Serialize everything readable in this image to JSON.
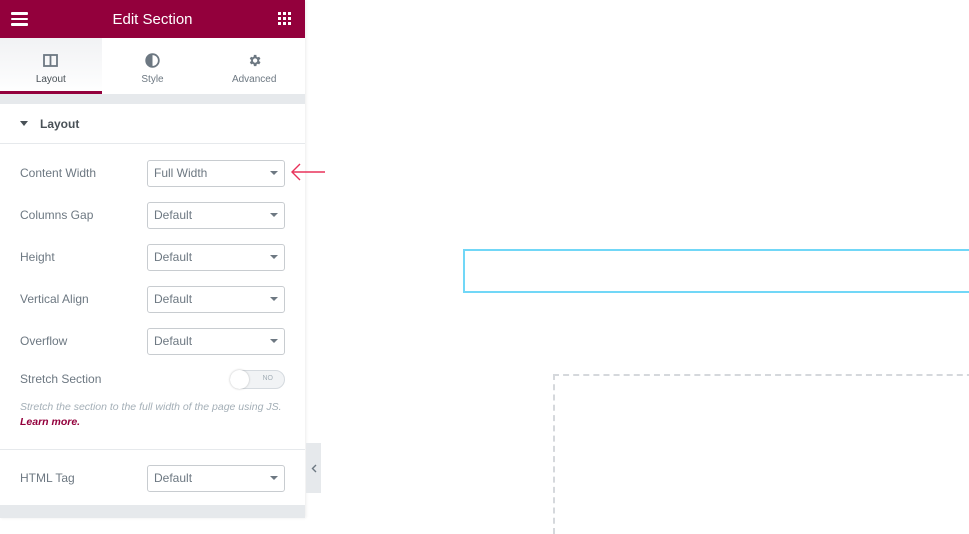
{
  "header": {
    "title": "Edit Section",
    "menu_icon": "hamburger-icon",
    "apps_icon": "grid-icon"
  },
  "tabs": [
    {
      "label": "Layout",
      "icon": "columns-icon",
      "active": true
    },
    {
      "label": "Style",
      "icon": "half-circle-icon",
      "active": false
    },
    {
      "label": "Advanced",
      "icon": "gear-icon",
      "active": false
    }
  ],
  "section": {
    "title": "Layout",
    "fields": [
      {
        "label": "Content Width",
        "value": "Full Width"
      },
      {
        "label": "Columns Gap",
        "value": "Default"
      },
      {
        "label": "Height",
        "value": "Default"
      },
      {
        "label": "Vertical Align",
        "value": "Default"
      },
      {
        "label": "Overflow",
        "value": "Default"
      }
    ],
    "stretch": {
      "label": "Stretch Section",
      "toggle_text": "NO",
      "description": "Stretch the section to the full width of the page using JS.",
      "link": "Learn more."
    },
    "html_tag": {
      "label": "HTML Tag",
      "value": "Default"
    }
  },
  "colors": {
    "brand": "#93003c",
    "annotation_arrow": "#e8325a",
    "selected_outline": "#71d7f7"
  }
}
